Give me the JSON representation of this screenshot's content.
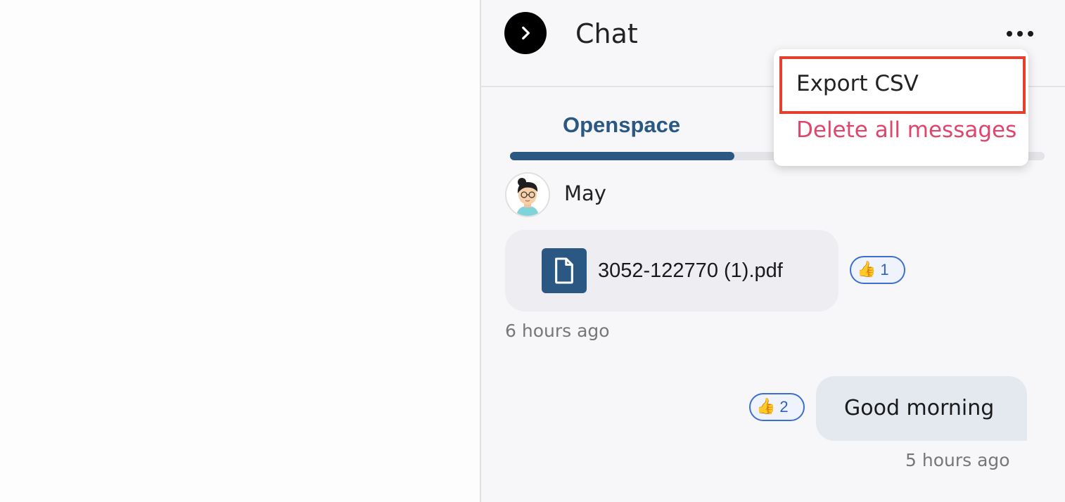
{
  "header": {
    "title": "Chat"
  },
  "tabs": {
    "active_label": "Openspace",
    "progress_fraction": 0.42
  },
  "messages": [
    {
      "sender": "May",
      "file_name": "3052-122770 (1).pdf",
      "reaction": {
        "emoji": "👍",
        "count": "1"
      },
      "time": "6 hours ago"
    },
    {
      "text": "Good morning",
      "reaction": {
        "emoji": "👍",
        "count": "2"
      },
      "time": "5 hours ago"
    }
  ],
  "menu": {
    "export_label": "Export CSV",
    "delete_label": "Delete all messages"
  },
  "colors": {
    "accent": "#2b5783",
    "danger": "#e0456c",
    "highlight": "#e2412f",
    "reaction_border": "#3d6fd0"
  }
}
